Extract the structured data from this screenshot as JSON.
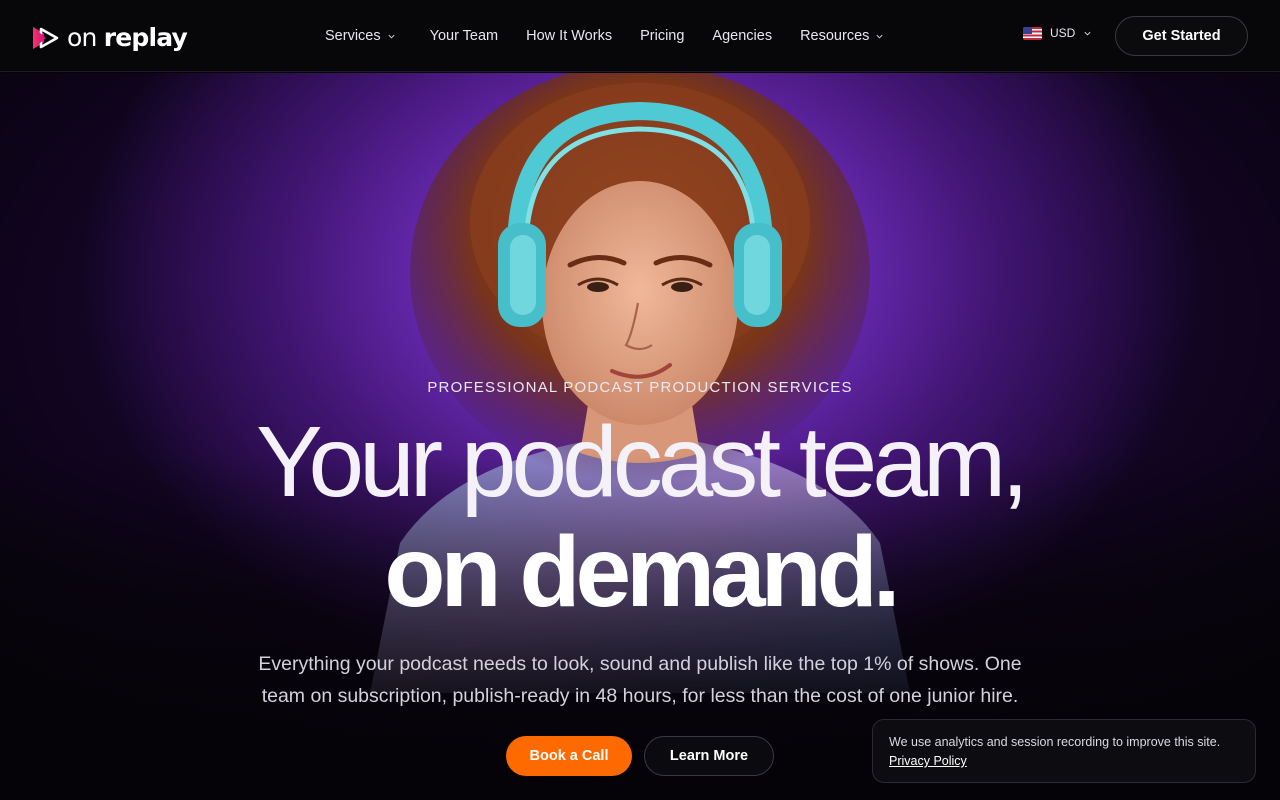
{
  "brand": {
    "name_light": "on",
    "name_bold": "replay",
    "logo_icon": "play-triangle-icon",
    "accent_pink": "#e8195e",
    "accent_orange": "#ff6a00"
  },
  "nav": {
    "items": [
      {
        "label": "Services",
        "has_dropdown": true
      },
      {
        "label": "Your Team",
        "has_dropdown": false
      },
      {
        "label": "How It Works",
        "has_dropdown": false
      },
      {
        "label": "Pricing",
        "has_dropdown": false
      },
      {
        "label": "Agencies",
        "has_dropdown": false
      },
      {
        "label": "Resources",
        "has_dropdown": true
      }
    ],
    "currency": {
      "label": "USD",
      "flag_icon": "us-flag-icon"
    },
    "cta_label": "Get Started"
  },
  "hero": {
    "eyebrow": "PROFESSIONAL PODCAST PRODUCTION SERVICES",
    "headline_line1": "Your podcast team,",
    "headline_line2": "on demand.",
    "subcopy": "Everything your podcast needs to look, sound and publish like the top 1% of shows. One team on subscription, publish-ready in 48 hours, for less than the cost of one junior hire.",
    "primary_cta": "Book a Call",
    "secondary_cta": "Learn More",
    "primary_color": "#ff6a00"
  },
  "cookie_banner": {
    "text": "We use analytics and session recording to improve this site.",
    "link_label": "Privacy Policy"
  }
}
